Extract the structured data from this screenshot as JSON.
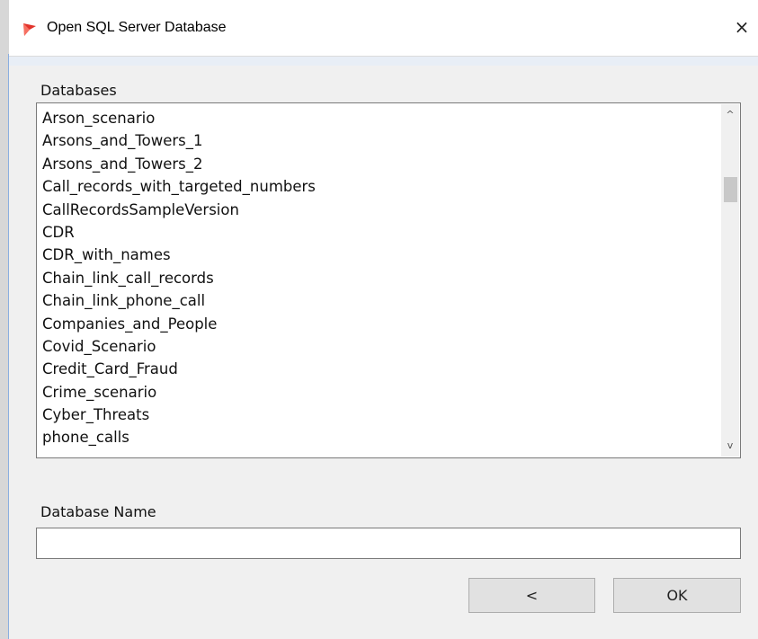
{
  "window": {
    "title": "Open SQL Server Database",
    "close_glyph": "×",
    "icon": "red-flag-icon"
  },
  "databases": {
    "label": "Databases",
    "items": [
      "Arson_scenario",
      "Arsons_and_Towers_1",
      "Arsons_and_Towers_2",
      "Call_records_with_targeted_numbers",
      "CallRecordsSampleVersion",
      "CDR",
      "CDR_with_names",
      "Chain_link_call_records",
      "Chain_link_phone_call",
      "Companies_and_People",
      "Covid_Scenario",
      "Credit_Card_Fraud",
      "Crime_scenario",
      "Cyber_Threats",
      "phone_calls"
    ],
    "scroll_up_glyph": "^",
    "scroll_down_glyph": "v"
  },
  "database_name": {
    "label": "Database Name",
    "value": ""
  },
  "buttons": {
    "back_label": "<",
    "ok_label": "OK"
  }
}
